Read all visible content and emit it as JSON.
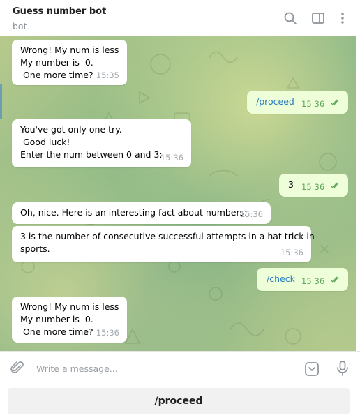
{
  "header": {
    "title": "Guess number bot",
    "status": "bot",
    "icons": [
      "search-icon",
      "sidebar-toggle-icon",
      "more-vertical-icon"
    ]
  },
  "messages": [
    {
      "direction": "incoming",
      "text": "Wrong! My num is less\nMy number is  0.\n One more time?",
      "time": "15:35"
    },
    {
      "direction": "outgoing",
      "text": "/proceed",
      "time": "15:36",
      "status": "read"
    },
    {
      "direction": "incoming",
      "text": "You've got only one try.\n Good luck!\nEnter the num between 0 and 3:",
      "time": "15:36"
    },
    {
      "direction": "outgoing",
      "text": "3",
      "time": "15:36",
      "status": "read"
    },
    {
      "direction": "incoming",
      "text": "Oh, nice. Here is an interesting fact about numbers:",
      "time": "15:36"
    },
    {
      "direction": "incoming",
      "text": "3 is the number of consecutive successful attempts in a hat trick in\nsports.",
      "time": "15:36"
    },
    {
      "direction": "outgoing",
      "text": "/check",
      "time": "15:36",
      "status": "read"
    },
    {
      "direction": "incoming",
      "text": "Wrong! My num is less\nMy number is  0.\n One more time?",
      "time": "15:36"
    }
  ],
  "composer": {
    "placeholder": "Write a message...",
    "value": "",
    "icons": [
      "paperclip-icon",
      "bot-keyboard-icon",
      "microphone-icon"
    ]
  },
  "keyboard": {
    "buttons": [
      "/proceed"
    ]
  },
  "colors": {
    "outgoing_bubble": "#eefed8",
    "incoming_bubble": "#ffffff",
    "command_link": "#2b7fc0",
    "read_ticks": "#5fa85b"
  }
}
